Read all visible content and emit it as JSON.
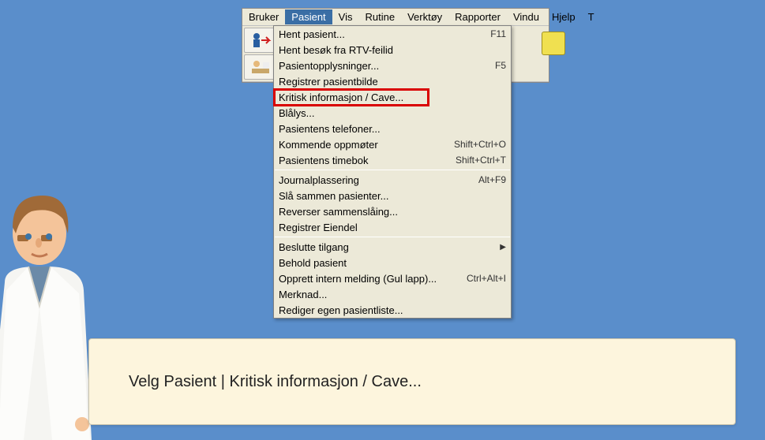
{
  "menubar": {
    "items": [
      "Bruker",
      "Pasient",
      "Vis",
      "Rutine",
      "Verktøy",
      "Rapporter",
      "Vindu",
      "Hjelp",
      "T"
    ],
    "active_index": 1
  },
  "dropdown": {
    "title": "Pasient",
    "highlight_index": 4,
    "groups": [
      [
        {
          "label": "Hent pasient...",
          "shortcut": "F11"
        },
        {
          "label": "Hent besøk fra RTV-feilid",
          "shortcut": ""
        },
        {
          "label": "Pasientopplysninger...",
          "shortcut": "F5"
        },
        {
          "label": "Registrer pasientbilde",
          "shortcut": ""
        },
        {
          "label": "Kritisk informasjon / Cave...",
          "shortcut": ""
        },
        {
          "label": "Blålys...",
          "shortcut": ""
        },
        {
          "label": "Pasientens telefoner...",
          "shortcut": ""
        },
        {
          "label": "Kommende oppmøter",
          "shortcut": "Shift+Ctrl+O"
        },
        {
          "label": "Pasientens timebok",
          "shortcut": "Shift+Ctrl+T"
        }
      ],
      [
        {
          "label": "Journalplassering",
          "shortcut": "Alt+F9"
        },
        {
          "label": "Slå sammen pasienter...",
          "shortcut": ""
        },
        {
          "label": "Reverser sammenslåing...",
          "shortcut": ""
        },
        {
          "label": "Registrer Eiendel",
          "shortcut": ""
        }
      ],
      [
        {
          "label": "Beslutte tilgang",
          "shortcut": "",
          "submenu": true
        },
        {
          "label": "Behold pasient",
          "shortcut": ""
        },
        {
          "label": "Opprett intern melding (Gul lapp)...",
          "shortcut": "Ctrl+Alt+I"
        },
        {
          "label": "Merknad...",
          "shortcut": ""
        },
        {
          "label": "Rediger egen pasientliste...",
          "shortcut": ""
        }
      ]
    ]
  },
  "callout_text": "Velg Pasient | Kritisk informasjon / Cave...",
  "toolbar_icons": [
    "person-arrow-icon",
    "person-desk-icon",
    "book-icon"
  ]
}
